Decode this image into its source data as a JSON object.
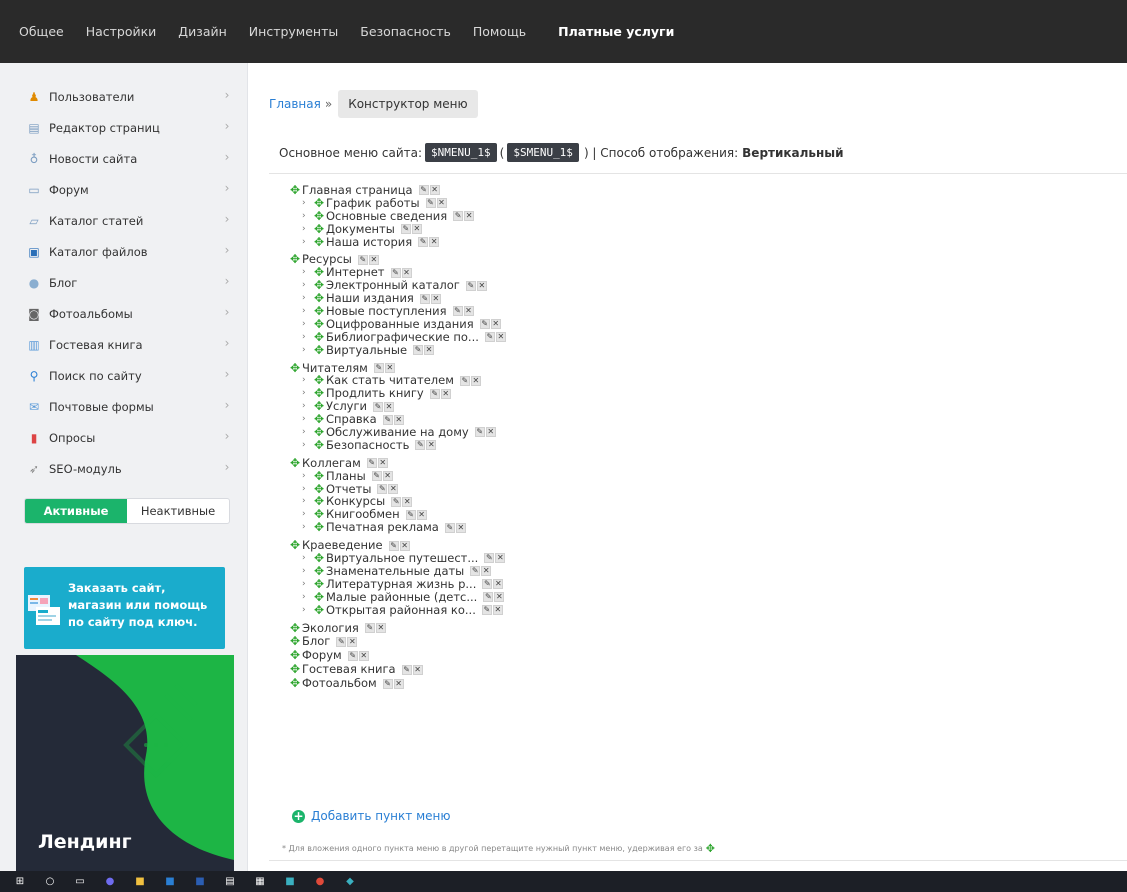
{
  "topnav": {
    "items": [
      "Общее",
      "Настройки",
      "Дизайн",
      "Инструменты",
      "Безопасность",
      "Помощь"
    ],
    "paid": "Платные услуги"
  },
  "sidebar": {
    "items": [
      {
        "label": "Пользователи",
        "icon": "user-icon"
      },
      {
        "label": "Редактор страниц",
        "icon": "page-icon"
      },
      {
        "label": "Новости сайта",
        "icon": "news-icon"
      },
      {
        "label": "Форум",
        "icon": "chat-icon"
      },
      {
        "label": "Каталог статей",
        "icon": "folder-icon"
      },
      {
        "label": "Каталог файлов",
        "icon": "save-icon"
      },
      {
        "label": "Блог",
        "icon": "blog-icon"
      },
      {
        "label": "Фотоальбомы",
        "icon": "camera-icon"
      },
      {
        "label": "Гостевая книга",
        "icon": "book-icon"
      },
      {
        "label": "Поиск по сайту",
        "icon": "search-icon"
      },
      {
        "label": "Почтовые формы",
        "icon": "mail-icon"
      },
      {
        "label": "Опросы",
        "icon": "chart-icon"
      },
      {
        "label": "SEO-модуль",
        "icon": "rocket-icon"
      }
    ],
    "tabs": {
      "active": "Активные",
      "inactive": "Неактивные"
    },
    "promo": {
      "line1": "Заказать сайт,",
      "line2": "магазин или помощь",
      "line3": "по сайту под ключ."
    },
    "banner": {
      "title": "Лендинг"
    }
  },
  "breadcrumb": {
    "home": "Главная",
    "sep": "»",
    "current": "Конструктор меню"
  },
  "info": {
    "label": "Основное меню сайта:",
    "code1": "$NMENU_1$",
    "paren_open": "(",
    "code2": "$SMENU_1$",
    "paren_close": ") | Способ отображения:",
    "mode": "Вертикальный"
  },
  "tree": [
    {
      "label": "Главная страница",
      "children": [
        "График работы",
        "Основные сведения",
        "Документы",
        "Наша история"
      ]
    },
    {
      "label": "Ресурсы",
      "children": [
        "Интернет",
        "Электронный каталог",
        "Наши издания",
        "Новые поступления",
        "Оцифрованные издания",
        "Библиографические по...",
        "Виртуальные"
      ]
    },
    {
      "label": "Читателям",
      "children": [
        "Как стать читателем",
        "Продлить книгу",
        "Услуги",
        "Справка",
        "Обслуживание на дому",
        "Безопасность"
      ]
    },
    {
      "label": "Коллегам",
      "children": [
        "Планы",
        "Отчеты",
        "Конкурсы",
        "Книгообмен",
        "Печатная реклама"
      ]
    },
    {
      "label": "Краеведение",
      "children": [
        "Виртуальное путешест...",
        "Знаменательные даты",
        "Литературная жизнь р...",
        "Малые районные (детс...",
        "Открытая районная ко..."
      ]
    },
    {
      "label": "Экология",
      "children": []
    },
    {
      "label": "Блог",
      "children": []
    },
    {
      "label": "Форум",
      "children": []
    },
    {
      "label": "Гостевая книга",
      "children": []
    },
    {
      "label": "Фотоальбом",
      "children": []
    }
  ],
  "add_item": "Добавить пункт меню",
  "footnote": "* Для вложения одного пункта меню в другой перетащите нужный пункт меню, удерживая его за"
}
